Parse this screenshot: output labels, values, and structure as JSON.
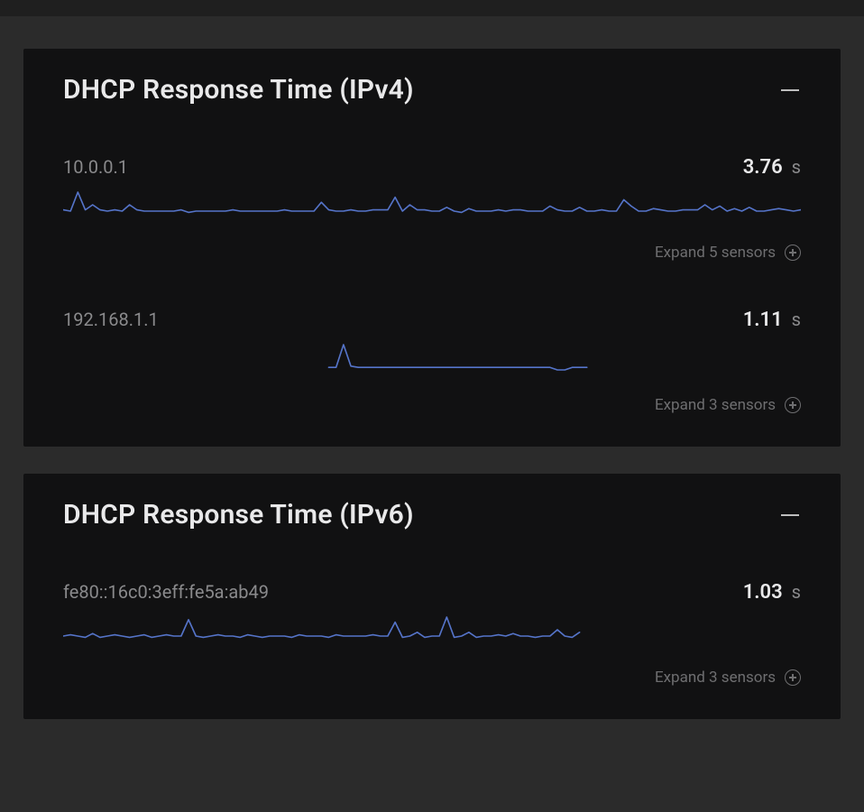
{
  "colors": {
    "line": "#5574c9"
  },
  "cards": [
    {
      "title": "DHCP Response Time (IPv4)",
      "sensors": [
        {
          "label": "10.0.0.1",
          "value": "3.76",
          "unit": "s",
          "expand": "Expand 5 sensors",
          "chart_data": {
            "type": "line",
            "x_range": [
              0,
              100
            ],
            "width_pct": 100,
            "values": [
              6,
              5,
              20,
              6,
              10,
              6,
              5,
              6,
              5,
              10,
              6,
              5,
              5,
              5,
              5,
              5,
              6,
              4,
              5,
              5,
              5,
              5,
              5,
              6,
              5,
              5,
              5,
              5,
              5,
              5,
              6,
              5,
              5,
              5,
              5,
              12,
              6,
              5,
              5,
              6,
              5,
              5,
              6,
              6,
              6,
              16,
              5,
              10,
              6,
              6,
              5,
              5,
              8,
              5,
              4,
              7,
              5,
              5,
              5,
              6,
              5,
              6,
              6,
              5,
              5,
              5,
              9,
              6,
              5,
              5,
              8,
              5,
              5,
              6,
              5,
              5,
              14,
              9,
              5,
              5,
              7,
              6,
              5,
              5,
              6,
              6,
              6,
              10,
              6,
              9,
              5,
              7,
              5,
              8,
              5,
              5,
              6,
              7,
              6,
              5,
              6
            ]
          }
        },
        {
          "label": "192.168.1.1",
          "value": "1.11",
          "unit": "s",
          "expand": "Expand 3 sensors",
          "chart_data": {
            "type": "line",
            "x_range": [
              36,
              71
            ],
            "width_pct": 100,
            "values": [
              2,
              2,
              20,
              3,
              2,
              2,
              2,
              2,
              2,
              2,
              2,
              2,
              2,
              2,
              2,
              2,
              2,
              2,
              2,
              2,
              2,
              2,
              2,
              2,
              2,
              2,
              2,
              2,
              2,
              2,
              2,
              0,
              0,
              2,
              2,
              2
            ]
          }
        }
      ]
    },
    {
      "title": "DHCP Response Time (IPv6)",
      "sensors": [
        {
          "label": "fe80::16c0:3eff:fe5a:ab49",
          "value": "1.03",
          "unit": "s",
          "expand": "Expand 3 sensors",
          "chart_data": {
            "type": "line",
            "x_range": [
              0,
              70
            ],
            "width_pct": 100,
            "values": [
              5,
              6,
              5,
              4,
              7,
              4,
              5,
              6,
              5,
              4,
              5,
              6,
              4,
              5,
              6,
              5,
              5,
              18,
              5,
              4,
              5,
              6,
              5,
              5,
              4,
              6,
              5,
              4,
              5,
              5,
              5,
              4,
              6,
              5,
              5,
              5,
              4,
              6,
              5,
              5,
              5,
              5,
              6,
              5,
              5,
              16,
              4,
              5,
              8,
              4,
              5,
              5,
              20,
              4,
              5,
              8,
              4,
              5,
              5,
              6,
              5,
              7,
              5,
              5,
              4,
              5,
              5,
              10,
              5,
              4,
              8
            ]
          }
        }
      ]
    }
  ]
}
